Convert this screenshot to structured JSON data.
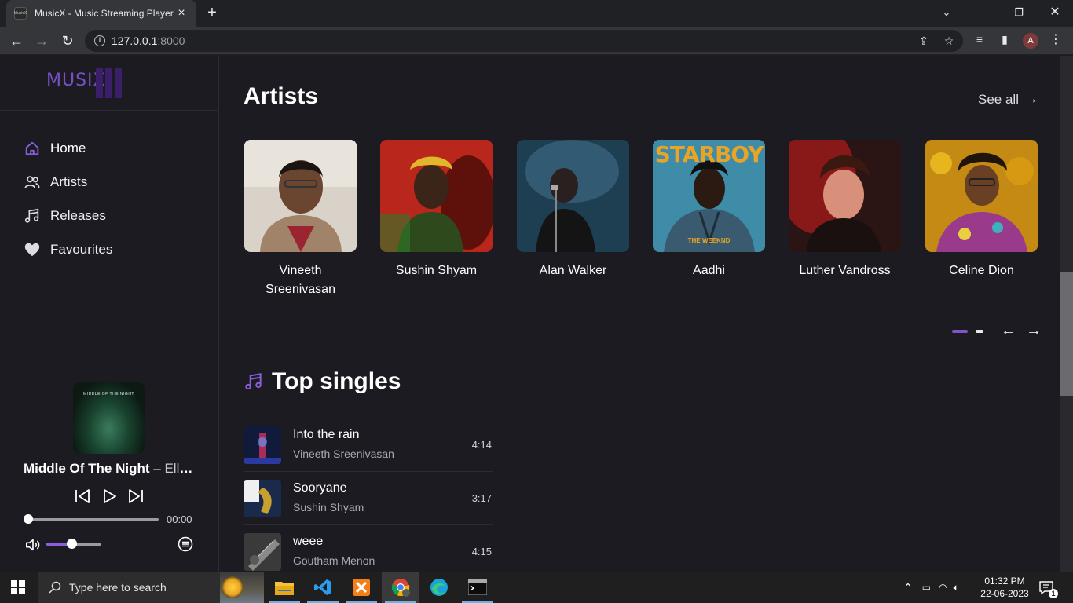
{
  "browser": {
    "tab_title": "MusicX - Music Streaming Player",
    "tab_favicon_text": "MusicX",
    "url_host": "127.0.0.1",
    "url_port": ":8000",
    "profile_initial": "A"
  },
  "sidebar": {
    "logo_text": "MUSIX",
    "nav": [
      {
        "label": "Home",
        "icon": "home-icon",
        "active": true
      },
      {
        "label": "Artists",
        "icon": "users-icon",
        "active": false
      },
      {
        "label": "Releases",
        "icon": "music-note-icon",
        "active": false
      },
      {
        "label": "Favourites",
        "icon": "heart-icon",
        "active": false
      }
    ]
  },
  "player": {
    "cover_text": "MIDDLE OF THE NIGHT",
    "title": "Middle Of The Night",
    "separator": " – ",
    "artist": "Elley Duhé",
    "time": "00:00",
    "progress": 0,
    "volume": 0.45
  },
  "artists_section": {
    "title": "Artists",
    "see_all": "See all",
    "artists": [
      {
        "name": "Vineeth Sreenivasan"
      },
      {
        "name": "Sushin Shyam"
      },
      {
        "name": "Alan Walker"
      },
      {
        "name": "Aadhi",
        "cover_top_text": "STARBOY",
        "cover_bottom_text": "THE WEEKND"
      },
      {
        "name": "Luther Vandross"
      },
      {
        "name": "Celine Dion"
      }
    ]
  },
  "top_singles": {
    "title": "Top singles",
    "items": [
      {
        "title": "Into the rain",
        "artist": "Vineeth Sreenivasan",
        "duration": "4:14"
      },
      {
        "title": "Sooryane",
        "artist": "Sushin Shyam",
        "duration": "3:17"
      },
      {
        "title": "weee",
        "artist": "Goutham Menon",
        "duration": "4:15"
      }
    ]
  },
  "taskbar": {
    "search_placeholder": "Type here to search",
    "time": "01:32 PM",
    "date": "22-06-2023",
    "notification_count": "1"
  },
  "colors": {
    "accent": "#7c55c8",
    "background": "#1c1b22"
  }
}
